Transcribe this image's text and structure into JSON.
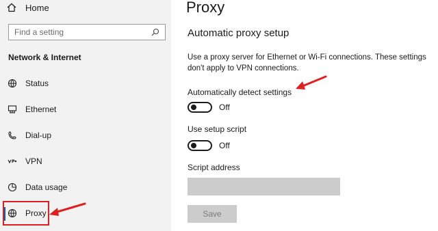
{
  "sidebar": {
    "home_label": "Home",
    "home_icon": "home-icon",
    "search_placeholder": "Find a setting",
    "search_icon": "search-icon",
    "section_title": "Network & Internet",
    "items": [
      {
        "label": "Status",
        "icon": "globe-status-icon"
      },
      {
        "label": "Ethernet",
        "icon": "ethernet-icon"
      },
      {
        "label": "Dial-up",
        "icon": "dial-up-icon"
      },
      {
        "label": "VPN",
        "icon": "vpn-icon"
      },
      {
        "label": "Data usage",
        "icon": "data-usage-icon"
      },
      {
        "label": "Proxy",
        "icon": "globe-icon",
        "selected": true
      }
    ]
  },
  "main": {
    "title": "Proxy",
    "subtitle": "Automatic proxy setup",
    "description": "Use a proxy server for Ethernet or Wi-Fi connections. These settings don't apply to VPN connections.",
    "auto_detect": {
      "label": "Automatically detect settings",
      "state": "Off"
    },
    "setup_script": {
      "label": "Use setup script",
      "state": "Off"
    },
    "script_address": {
      "label": "Script address",
      "value": ""
    },
    "save_label": "Save"
  },
  "colors": {
    "sidebar_bg": "#f2f2f2",
    "accent": "#0063b1",
    "annotation_red": "#e02020",
    "disabled_fill": "#cccccc"
  }
}
